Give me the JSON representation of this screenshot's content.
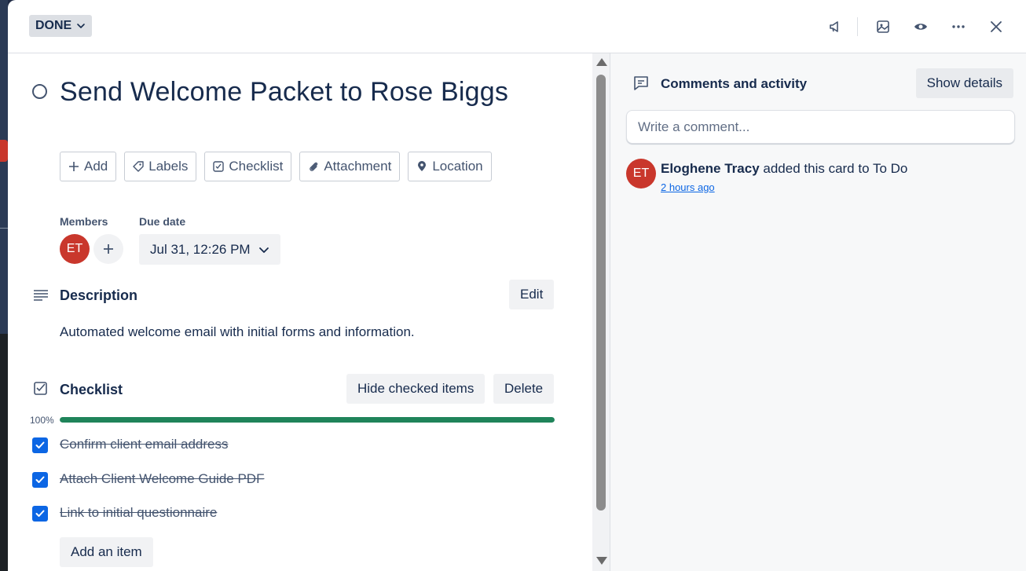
{
  "header": {
    "status_label": "DONE"
  },
  "card": {
    "title": "Send Welcome Packet to Rose Biggs"
  },
  "actions": [
    {
      "label": "Add",
      "icon": "plus-icon"
    },
    {
      "label": "Labels",
      "icon": "tag-icon"
    },
    {
      "label": "Checklist",
      "icon": "checklist-icon"
    },
    {
      "label": "Attachment",
      "icon": "paperclip-icon"
    },
    {
      "label": "Location",
      "icon": "location-pin-icon"
    }
  ],
  "members": {
    "label": "Members",
    "avatar_initials": "ET"
  },
  "due": {
    "label": "Due date",
    "value": "Jul 31, 12:26 PM"
  },
  "description": {
    "title": "Description",
    "edit_label": "Edit",
    "text": "Automated welcome email with initial forms and information."
  },
  "checklist": {
    "title": "Checklist",
    "hide_label": "Hide checked items",
    "delete_label": "Delete",
    "percent_label": "100%",
    "progress": 1.0,
    "items": [
      {
        "text": "Confirm client email address",
        "checked": true
      },
      {
        "text": "Attach Client Welcome Guide PDF",
        "checked": true
      },
      {
        "text": "Link to initial questionnaire",
        "checked": true
      }
    ],
    "add_item_label": "Add an item"
  },
  "comments": {
    "title": "Comments and activity",
    "show_details_label": "Show details",
    "input_placeholder": "Write a comment...",
    "activity": {
      "avatar_initials": "ET",
      "user": "Eloghene Tracy",
      "action": " added this card to To Do",
      "time": "2 hours ago"
    }
  },
  "colors": {
    "accent": "#0c66e4",
    "progress": "#1f845a",
    "avatar": "#c9372c"
  }
}
